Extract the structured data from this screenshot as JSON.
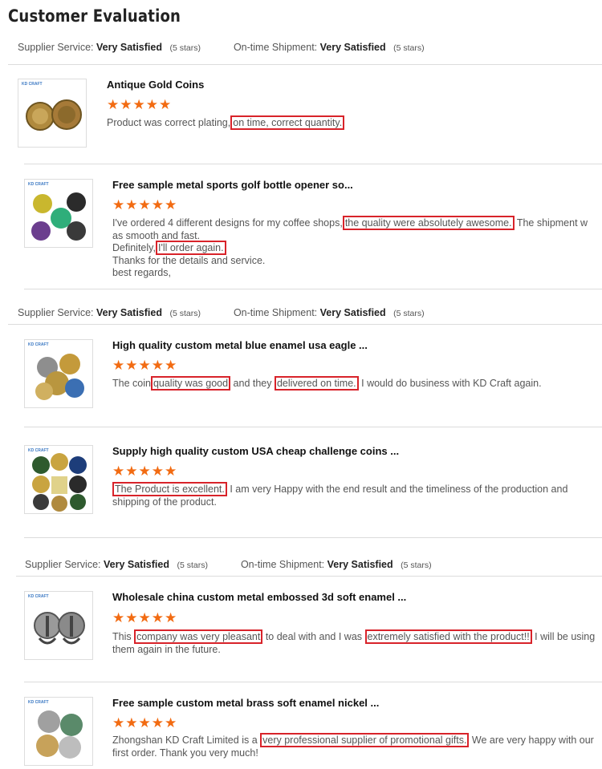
{
  "page": {
    "title": "Customer Evaluation"
  },
  "rating_label_supplier": "Supplier Service:",
  "rating_label_shipment": "On-time Shipment:",
  "rating_value": "Very Satisfied",
  "rating_stars_note": "(5 stars)",
  "star_glyphs": "★★★★★",
  "colors": {
    "star": "#f26b12",
    "highlight_border": "#d8232a",
    "brand": "#3a78c3"
  },
  "thumb_brand": "KD CRAFT",
  "reviews": [
    {
      "product_title": "Antique Gold Coins",
      "stars": 5,
      "comment": [
        "Product was correct plating,",
        "on time, correct quantity."
      ]
    },
    {
      "product_title": "Free sample metal sports golf bottle opener so...",
      "stars": 5,
      "comment": [
        "I've ordered 4 different designs for my coffee shops,",
        "the quality were absolutely awesome.",
        " The shipment w",
        "as smooth and fast.",
        "Definitely,",
        "I'll order again.",
        "Thanks for the details and service.",
        "best regards,"
      ]
    },
    {
      "product_title": "High quality custom metal blue enamel usa eagle  ...",
      "stars": 5,
      "comment": [
        "The coin",
        "quality was good",
        " and they ",
        "delivered on time.",
        "  I would do business with KD Craft again."
      ]
    },
    {
      "product_title": "Supply high quality custom USA cheap challenge coins ...",
      "stars": 5,
      "comment": [
        "The Product is excellent.",
        " I am very Happy with the end result and the timeliness of the production and",
        "shipping of the product."
      ]
    },
    {
      "product_title": "Wholesale china custom metal embossed 3d soft enamel ...",
      "stars": 5,
      "comment": [
        "This ",
        "company was very pleasant",
        " to deal with and I was ",
        "extremely satisfied with the product!!",
        " I will be using",
        "them again in the future."
      ]
    },
    {
      "product_title": "Free sample custom metal brass soft enamel nickel ...",
      "stars": 5,
      "comment": [
        "Zhongshan KD Craft Limited is a ",
        "very professional supplier of promotional gifts.",
        " We are very happy with our",
        "first order. Thank you very much!"
      ]
    }
  ]
}
